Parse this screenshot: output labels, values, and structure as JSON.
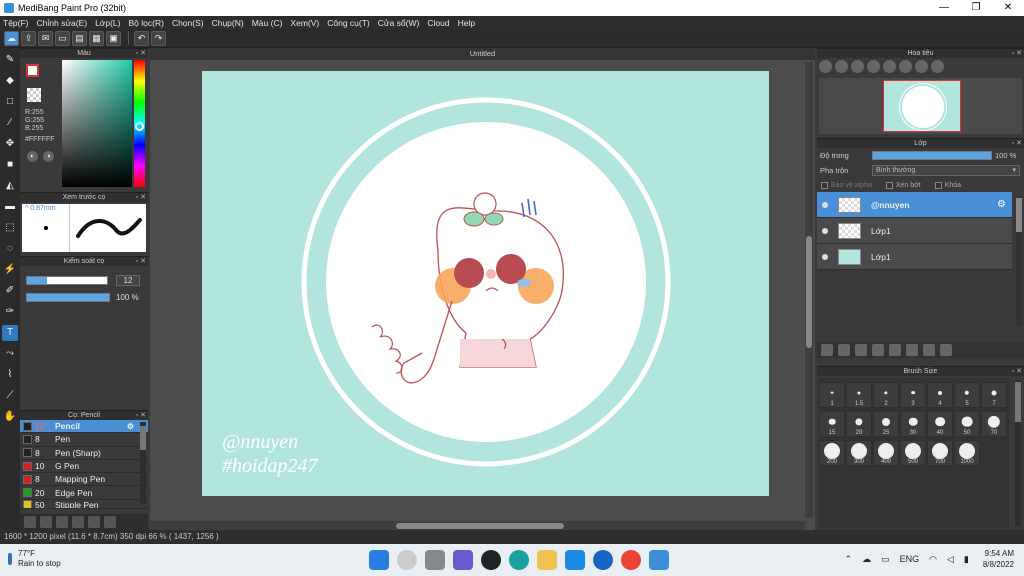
{
  "window": {
    "title": "MediBang Paint Pro (32bit)",
    "min": "—",
    "max": "❐",
    "close": "✕"
  },
  "menu": [
    "Tệp(F)",
    "Chỉnh sửa(E)",
    "Lớp(L)",
    "Bộ lọc(R)",
    "Chọn(S)",
    "Chụp(N)",
    "Màu (C)",
    "Xem(V)",
    "Công cụ(T)",
    "Cửa sổ(W)",
    "Cloud",
    "Help"
  ],
  "color_panel": {
    "title": "Màu",
    "rgb": [
      "R:255",
      "G:255",
      "B:255"
    ],
    "hex": "#FFFFFF",
    "fg_color": "#ffffff",
    "accent": "#21c8a8"
  },
  "preview_panel": {
    "title": "Xem trước cọ",
    "size": "0.87mm"
  },
  "brush_control": {
    "title": "Kiểm soát cọ",
    "size_value": "12",
    "size_fill": 0.25,
    "opacity_value": "100 %",
    "opacity_fill": 1.0
  },
  "brush_list": {
    "title": "Cọ: Pencil",
    "items": [
      {
        "size": "12",
        "name": "Pencil",
        "color": "#222222",
        "selected": true
      },
      {
        "size": "8",
        "name": "Pen",
        "color": "#222222"
      },
      {
        "size": "8",
        "name": "Pen (Sharp)",
        "color": "#222222"
      },
      {
        "size": "10",
        "name": "G Pen",
        "color": "#d42020"
      },
      {
        "size": "8",
        "name": "Mapping Pen",
        "color": "#d42020"
      },
      {
        "size": "20",
        "name": "Edge Pen",
        "color": "#20a020"
      },
      {
        "size": "50",
        "name": "Stipple Pen",
        "color": "#e0c020"
      }
    ]
  },
  "canvas": {
    "doc_title": "Untitled",
    "background": "#b2e5dd",
    "watermark_line1": "@nnuyen",
    "watermark_line2": "#hoidap247"
  },
  "navigator": {
    "title": "Hoa tiêu"
  },
  "layers": {
    "title": "Lớp",
    "opacity_label": "Độ trong",
    "opacity_value": "100 %",
    "blend_label": "Pha trộn",
    "blend_value": "Bình thường",
    "check_alpha": "Bảo vệ alpha",
    "check_clip": "Xén bớt",
    "check_lock": "Khóa",
    "items": [
      {
        "name": "@nnuyen",
        "selected": true,
        "thumb": "checker"
      },
      {
        "name": "Lớp1",
        "selected": false,
        "thumb": "checker"
      },
      {
        "name": "Lớp1",
        "selected": false,
        "thumb": "teal"
      }
    ]
  },
  "brush_size": {
    "title": "Brush Size",
    "sizes": [
      "1",
      "1.5",
      "2",
      "3",
      "4",
      "5",
      "7",
      "15",
      "20",
      "25",
      "30",
      "40",
      "50",
      "70",
      "200",
      "300",
      "400",
      "500",
      "700",
      "1000"
    ]
  },
  "status": {
    "text": "1600 * 1200 pixel   (11.6 * 8.7cm)   350 dpi   66 %   ( 1437, 1256 )"
  },
  "taskbar": {
    "temperature": "77°F",
    "weather": "Rain to stop",
    "language": "ENG",
    "time": "9:54 AM",
    "date": "8/8/2022"
  }
}
